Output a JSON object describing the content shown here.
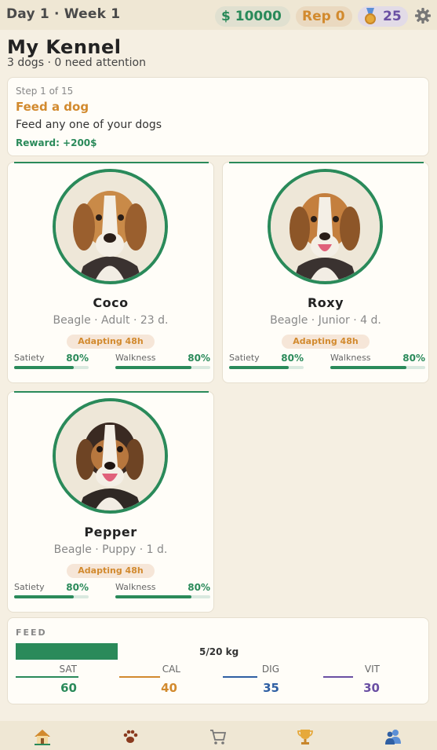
{
  "header": {
    "day_week": "Day 1 · Week 1",
    "money": "$ 10000",
    "rep": "Rep 0",
    "medals": "25"
  },
  "page": {
    "title": "My Kennel",
    "subtitle": "3 dogs · 0 need attention"
  },
  "task": {
    "step": "Step 1 of 15",
    "name": "Feed a dog",
    "description": "Feed any one of your dogs",
    "reward": "Reward: +200$"
  },
  "dogs": [
    {
      "name": "Coco",
      "info": "Beagle · Adult · 23 d.",
      "badge": "Adapting 48h",
      "satiety_label": "Satiety",
      "satiety": "80%",
      "walkness_label": "Walkness",
      "walkness": "80%",
      "satiety_frac": 0.8,
      "walkness_frac": 0.8
    },
    {
      "name": "Roxy",
      "info": "Beagle · Junior · 4 d.",
      "badge": "Adapting 48h",
      "satiety_label": "Satiety",
      "satiety": "80%",
      "walkness_label": "Walkness",
      "walkness": "80%",
      "satiety_frac": 0.8,
      "walkness_frac": 0.8
    },
    {
      "name": "Pepper",
      "info": "Beagle · Puppy · 1 d.",
      "badge": "Adapting 48h",
      "satiety_label": "Satiety",
      "satiety": "80%",
      "walkness_label": "Walkness",
      "walkness": "80%",
      "satiety_frac": 0.8,
      "walkness_frac": 0.8
    }
  ],
  "feed": {
    "title": "FEED",
    "amount": "5/20 kg",
    "fill_frac": 0.25,
    "nutrients": [
      {
        "label": "SAT",
        "value": "60",
        "color": "#2a8a5a"
      },
      {
        "label": "CAL",
        "value": "40",
        "color": "#d28a2e"
      },
      {
        "label": "DIG",
        "value": "35",
        "color": "#2f5fa3"
      },
      {
        "label": "VIT",
        "value": "30",
        "color": "#6a4fa3"
      }
    ]
  },
  "nav": [
    "home-icon",
    "paw-icon",
    "cart-icon",
    "trophy-icon",
    "user-icon"
  ]
}
